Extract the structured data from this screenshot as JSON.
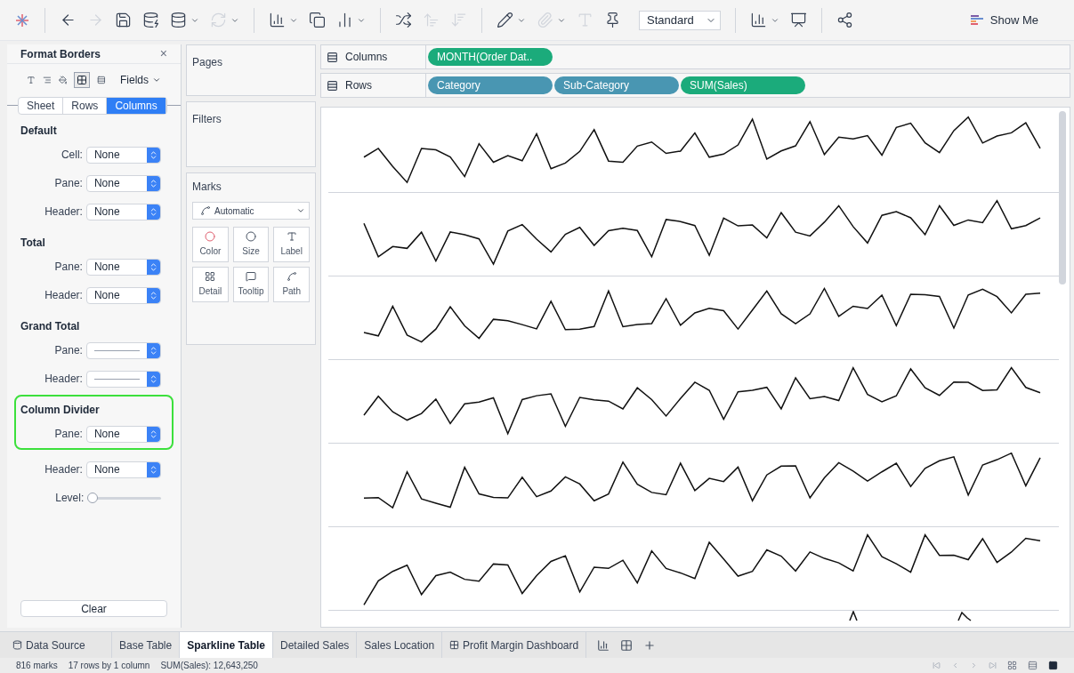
{
  "toolbar": {
    "view_mode": "Standard",
    "show_me": "Show Me"
  },
  "format_panel": {
    "title": "Format Borders",
    "close": "×",
    "fields": "Fields",
    "tabs": [
      {
        "label": "Sheet",
        "selected": false
      },
      {
        "label": "Rows",
        "selected": false
      },
      {
        "label": "Columns",
        "selected": true
      }
    ],
    "sections": [
      {
        "title": "Default",
        "highlighted": false,
        "rows": [
          {
            "kind": "select",
            "label": "Cell:",
            "value": "None"
          },
          {
            "kind": "select",
            "label": "Pane:",
            "value": "None"
          },
          {
            "kind": "select",
            "label": "Header:",
            "value": "None"
          }
        ]
      },
      {
        "title": "Total",
        "highlighted": false,
        "rows": [
          {
            "kind": "select",
            "label": "Pane:",
            "value": "None"
          },
          {
            "kind": "select",
            "label": "Header:",
            "value": "None"
          }
        ]
      },
      {
        "title": "Grand Total",
        "highlighted": false,
        "rows": [
          {
            "kind": "line",
            "label": "Pane:"
          },
          {
            "kind": "line",
            "label": "Header:"
          }
        ]
      },
      {
        "title": "Column Divider",
        "highlighted": true,
        "rows": [
          {
            "kind": "select",
            "label": "Pane:",
            "value": "None"
          }
        ]
      },
      {
        "highlighted": false,
        "rows": [
          {
            "kind": "select",
            "label": "Header:",
            "value": "None"
          },
          {
            "kind": "slider",
            "label": "Level:",
            "level": 0
          }
        ]
      }
    ],
    "clear": "Clear"
  },
  "pages": {
    "title": "Pages"
  },
  "filters": {
    "title": "Filters"
  },
  "marks": {
    "title": "Marks",
    "mark_type": "Automatic",
    "cards": [
      "Color",
      "Size",
      "Label",
      "Detail",
      "Tooltip",
      "Path"
    ]
  },
  "columns_shelf": {
    "label": "Columns",
    "pills": [
      {
        "text": "MONTH(Order Dat..",
        "color": "#1bab7b"
      }
    ]
  },
  "rows_shelf": {
    "label": "Rows",
    "pills": [
      {
        "text": "Category",
        "color": "#4996b2"
      },
      {
        "text": "Sub-Category",
        "color": "#4996b2"
      },
      {
        "text": "SUM(Sales)",
        "color": "#1bab7b"
      }
    ]
  },
  "sheet_tabs": [
    {
      "label": "Data Source",
      "kind": "datasource",
      "selected": false
    },
    {
      "label": "Base Table",
      "kind": "sheet",
      "selected": false
    },
    {
      "label": "Sparkline Table",
      "kind": "sheet",
      "selected": true
    },
    {
      "label": "Detailed Sales",
      "kind": "sheet",
      "selected": false
    },
    {
      "label": "Sales Location",
      "kind": "sheet",
      "selected": false
    },
    {
      "label": "Profit Margin Dashboard",
      "kind": "dashboard",
      "selected": false
    }
  ],
  "status_bar": [
    "816 marks",
    "17 rows by 1 column",
    "SUM(Sales): 12,643,250"
  ]
}
